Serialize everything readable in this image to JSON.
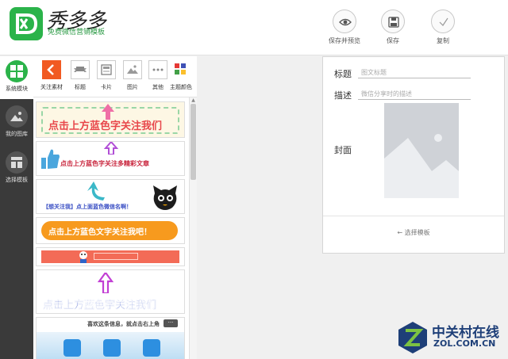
{
  "brand": {
    "name": "秀多多",
    "tagline": "免费微信营销模板"
  },
  "toolbar": [
    {
      "label": "保存并预览",
      "icon": "eye-icon"
    },
    {
      "label": "保存",
      "icon": "save-icon"
    },
    {
      "label": "复制",
      "icon": "check-icon"
    }
  ],
  "sidebar": [
    {
      "label": "系统模块",
      "icon": "grid-icon",
      "active": true
    },
    {
      "label": "我的图库",
      "icon": "image-icon",
      "active": false
    },
    {
      "label": "选择模板",
      "icon": "template-icon",
      "active": false
    }
  ],
  "modules": [
    {
      "label": "关注素材",
      "icon": "share-arrow-icon"
    },
    {
      "label": "标题",
      "icon": "ribbon-icon"
    },
    {
      "label": "卡片",
      "icon": "card-icon"
    },
    {
      "label": "图片",
      "icon": "picture-icon"
    },
    {
      "label": "其他",
      "icon": "more-dots-icon"
    },
    {
      "label": "主题颜色",
      "icon": "palette-icon"
    }
  ],
  "templates": [
    {
      "text": "点击上方蓝色字关注我们"
    },
    {
      "text": "点击上方蓝色字关注多精彩文章"
    },
    {
      "text": "【想关注我】点上面蓝色微信名啊！"
    },
    {
      "text": "点击上方蓝色文字关注我吧！"
    },
    {
      "text": "点击上方蓝色字关注我们"
    },
    {
      "text": "喜欢这条信息，就点击右上角"
    }
  ],
  "form": {
    "title_label": "标题",
    "title_placeholder": "图文标题",
    "desc_label": "描述",
    "desc_placeholder": "微信分享时的描述",
    "cover_label": "封面",
    "choose_template": "← 选择模板"
  },
  "watermark": {
    "line1": "中关村在线",
    "line2": "ZOL.COM.CN"
  }
}
